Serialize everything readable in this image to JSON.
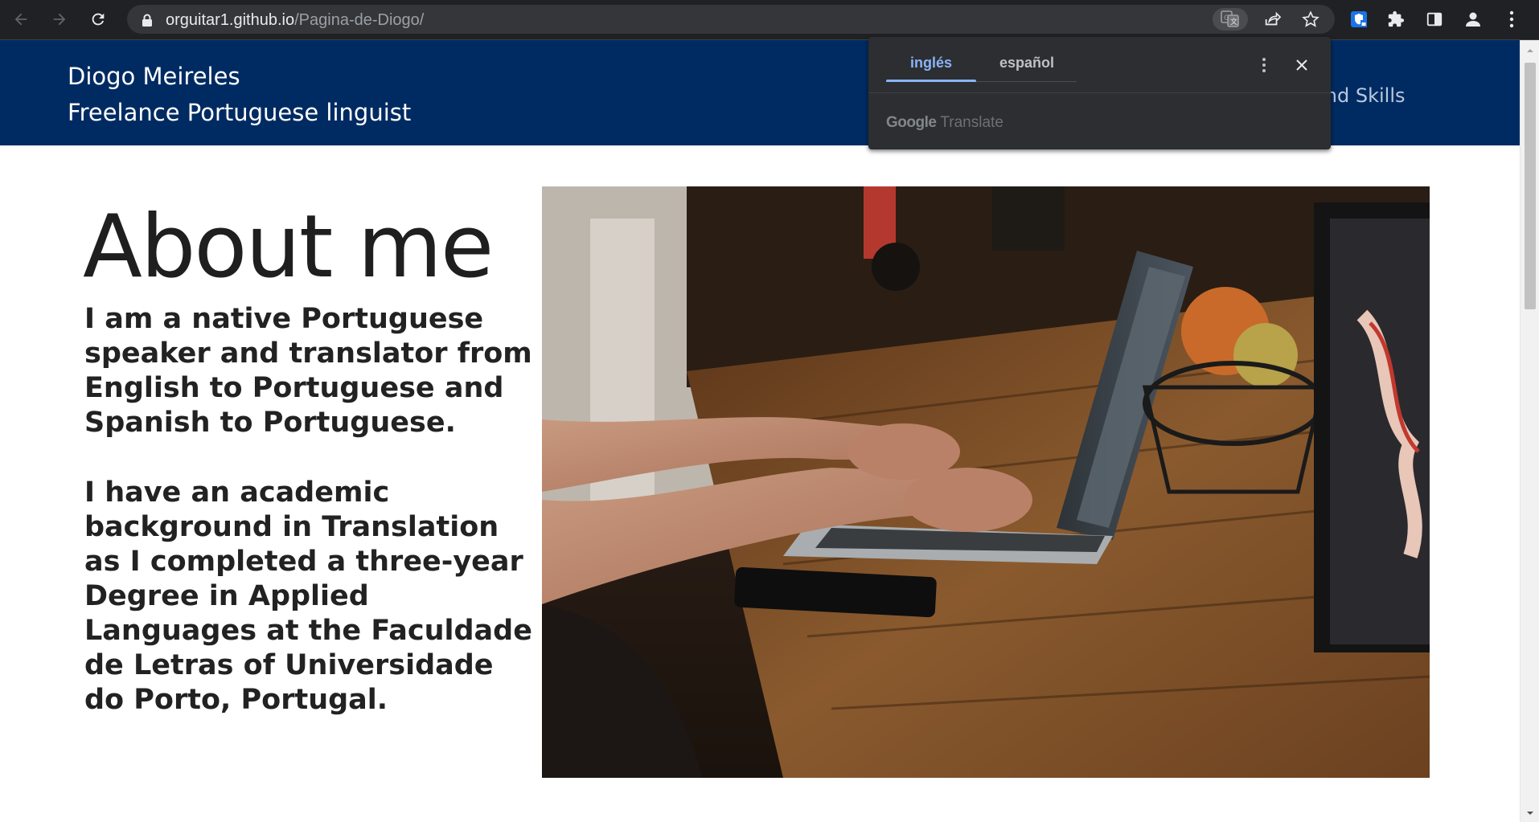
{
  "browser": {
    "url_host": "orguitar1.github.io",
    "url_path": "/Pagina-de-Diogo/",
    "icons": [
      "back-icon",
      "forward-icon",
      "reload-icon",
      "lock-icon",
      "translate-icon",
      "share-icon",
      "star-icon",
      "extension-shield-icon",
      "puzzle-icon",
      "side-panel-icon",
      "profile-icon",
      "menu-icon"
    ]
  },
  "site": {
    "name": "Diogo Meireles",
    "tagline": "Freelance Portuguese linguist",
    "nav_visible_text": "nd and Skills"
  },
  "translate_popup": {
    "tabs": [
      {
        "label": "inglés",
        "active": true
      },
      {
        "label": "español",
        "active": false
      }
    ],
    "footer_brand": "Google",
    "footer_text": "Translate"
  },
  "main": {
    "heading": "About me",
    "paragraph1": "I am a native Portuguese speaker and translator from English to Portuguese and Spanish to Portuguese.",
    "paragraph2": "I have an academic background in Translation as I completed a three-year Degree in Applied Languages at the Faculdade de Letras of Universidade do Porto, Portugal."
  },
  "colors": {
    "chrome_bg": "#202124",
    "header_bg": "#002b62",
    "accent_blue": "#8ab4f8"
  }
}
